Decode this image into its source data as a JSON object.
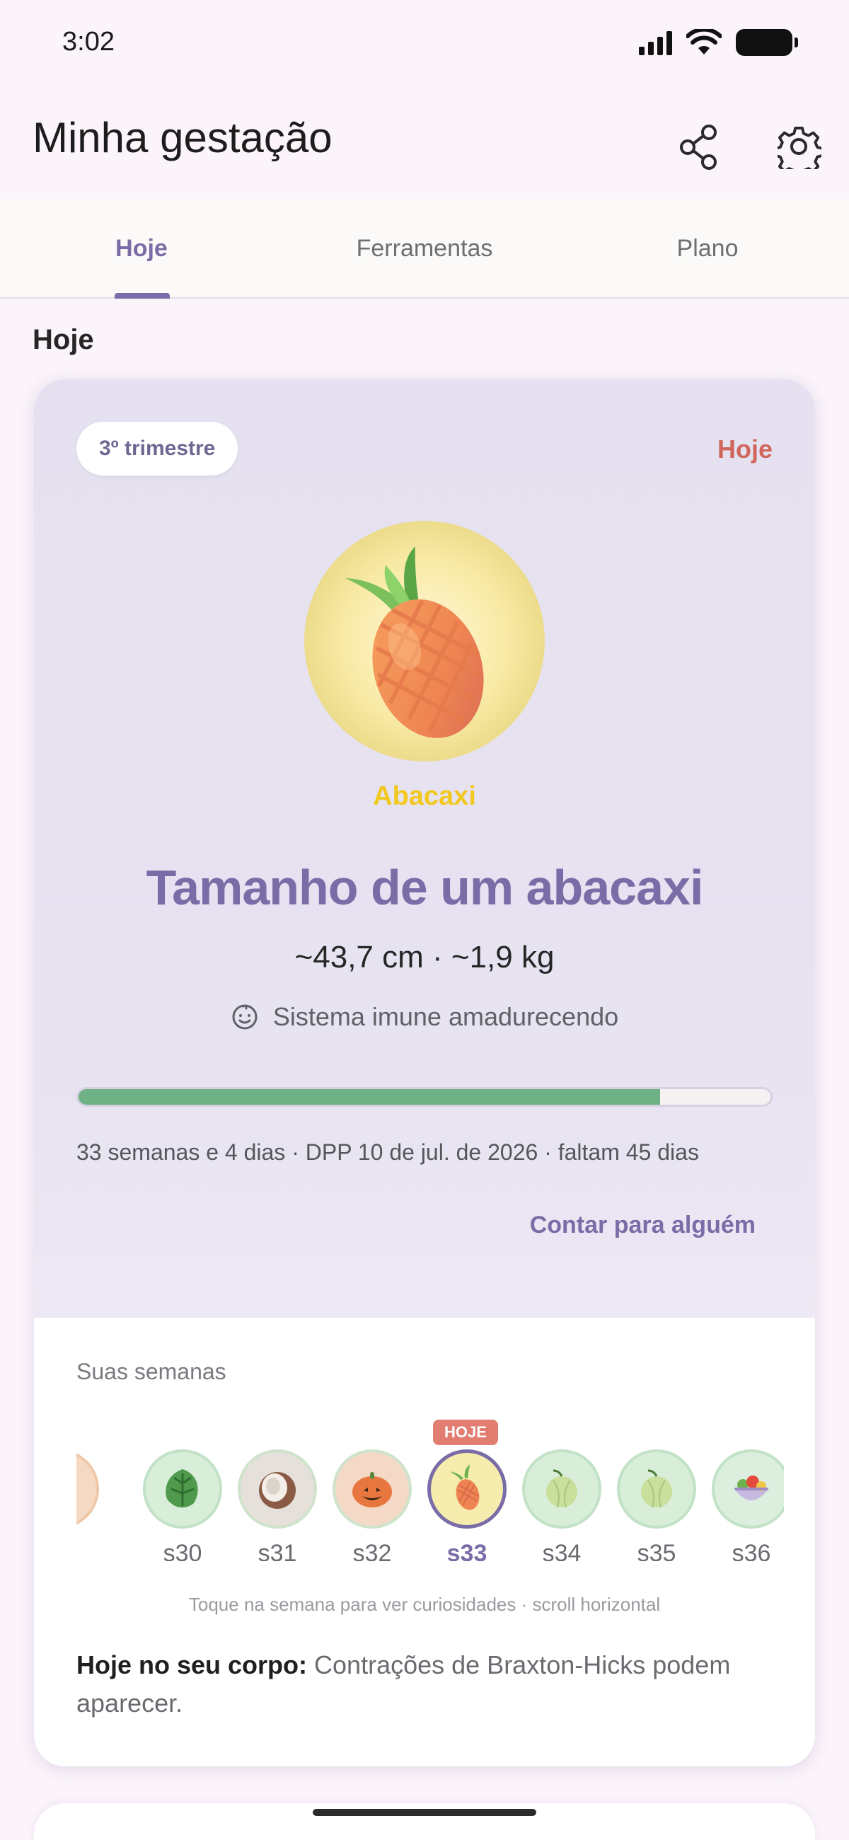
{
  "status_bar": {
    "time": "3:02"
  },
  "header": {
    "title": "Minha gestação",
    "share_icon": "share-icon",
    "settings_icon": "gear-icon"
  },
  "tabs": [
    {
      "label": "Hoje",
      "active": true
    },
    {
      "label": "Ferramentas",
      "active": false
    },
    {
      "label": "Plano",
      "active": false
    }
  ],
  "section_title": "Hoje",
  "hero": {
    "trimester": "3º trimestre",
    "today_link": "Hoje",
    "fruit_label": "Abacaxi",
    "size_title": "Tamanho de um abacaxi",
    "measures": "~43,7 cm · ~1,9 kg",
    "milestone_icon": "baby-face-icon",
    "milestone": "Sistema imune amadurecendo",
    "progress_fraction": 0.84,
    "pregnancy_line": "33 semanas e 4 dias · DPP 10 de jul. de 2026 · faltam 45 dias",
    "share_link": "Contar para alguém"
  },
  "weeks": {
    "label": "Suas semanas",
    "today_badge": "HOJE",
    "items": [
      {
        "label": "s30",
        "icon": "spinach-icon"
      },
      {
        "label": "s31",
        "icon": "coconut-icon"
      },
      {
        "label": "s32",
        "icon": "pumpkin-icon"
      },
      {
        "label": "s33",
        "icon": "pineapple-icon",
        "current": true
      },
      {
        "label": "s34",
        "icon": "melon-icon"
      },
      {
        "label": "s35",
        "icon": "melon-icon"
      },
      {
        "label": "s36",
        "icon": "salad-icon"
      }
    ],
    "hint": "Toque na semana para ver curiosidades · scroll horizontal"
  },
  "body_today": {
    "lead": "Hoje no seu corpo:",
    "text": " Contrações de Braxton-Hicks podem aparecer."
  },
  "colors": {
    "accent": "#7a6ca6",
    "today": "#d0665c",
    "progress": "#6db184",
    "fruit_label": "#f2c81e"
  }
}
